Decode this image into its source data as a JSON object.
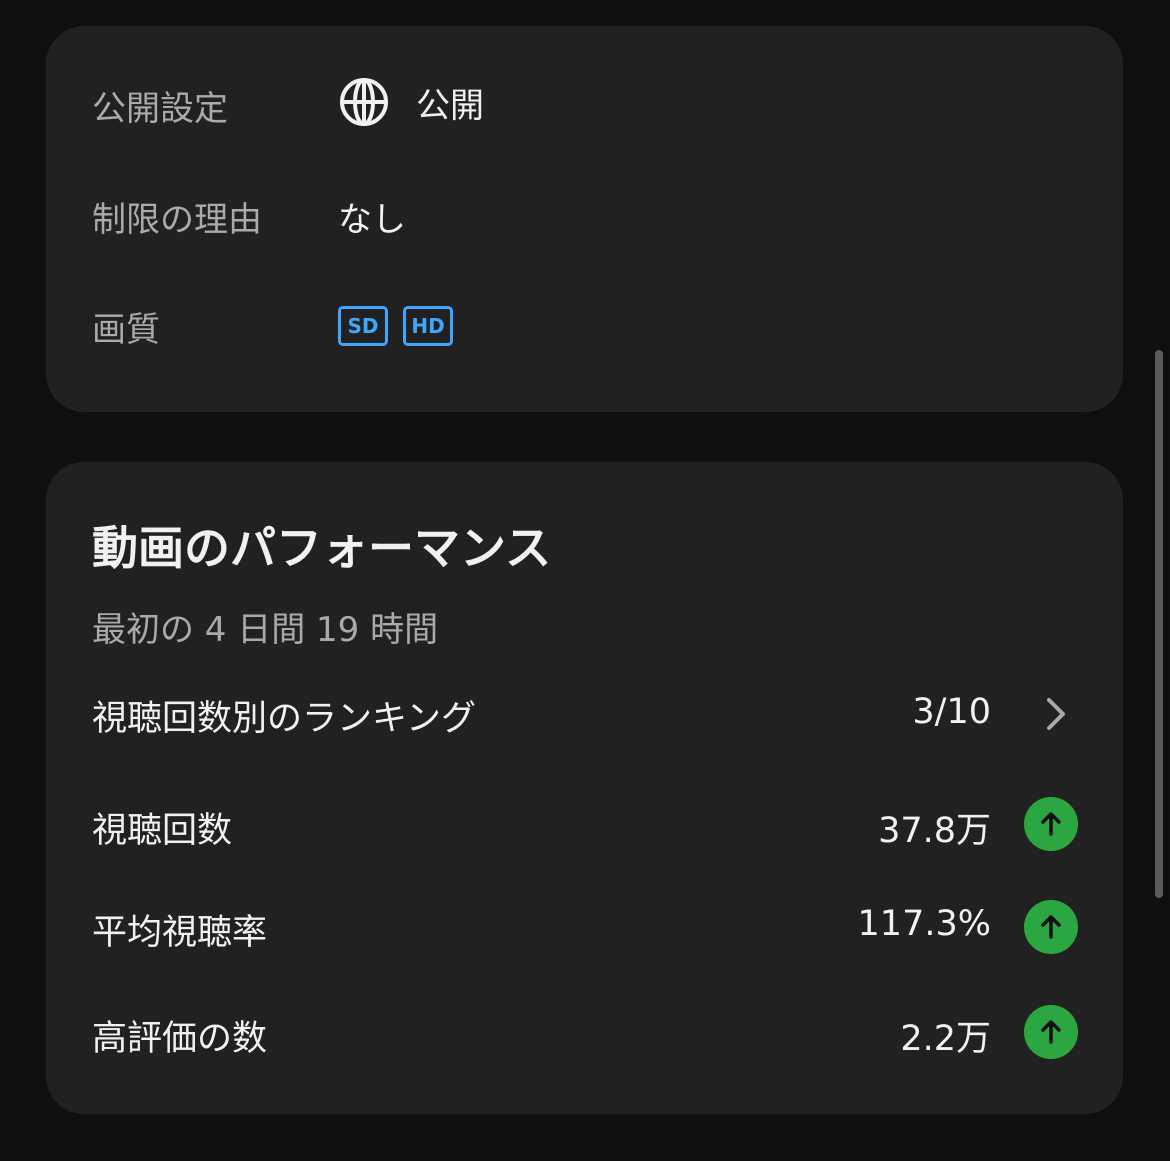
{
  "settings": {
    "visibility": {
      "label": "公開設定",
      "value": "公開",
      "icon": "globe-icon"
    },
    "restriction": {
      "label": "制限の理由",
      "value": "なし"
    },
    "quality": {
      "label": "画質",
      "badges": [
        "SD",
        "HD"
      ]
    }
  },
  "performance": {
    "title": "動画のパフォーマンス",
    "subtitle": "最初の 4 日間 19 時間",
    "ranking": {
      "label": "視聴回数別のランキング",
      "value": "3/10",
      "icon": "chevron-right-icon"
    },
    "metrics": [
      {
        "label": "視聴回数",
        "value": "37.8万",
        "trend": "up"
      },
      {
        "label": "平均視聴率",
        "value": "117.3%",
        "trend": "up"
      },
      {
        "label": "高評価の数",
        "value": "2.2万",
        "trend": "up"
      }
    ]
  },
  "colors": {
    "background": "#0f0f0f",
    "card": "#212121",
    "badge_blue": "#3ea6ff",
    "trend_green": "#2ba640"
  }
}
